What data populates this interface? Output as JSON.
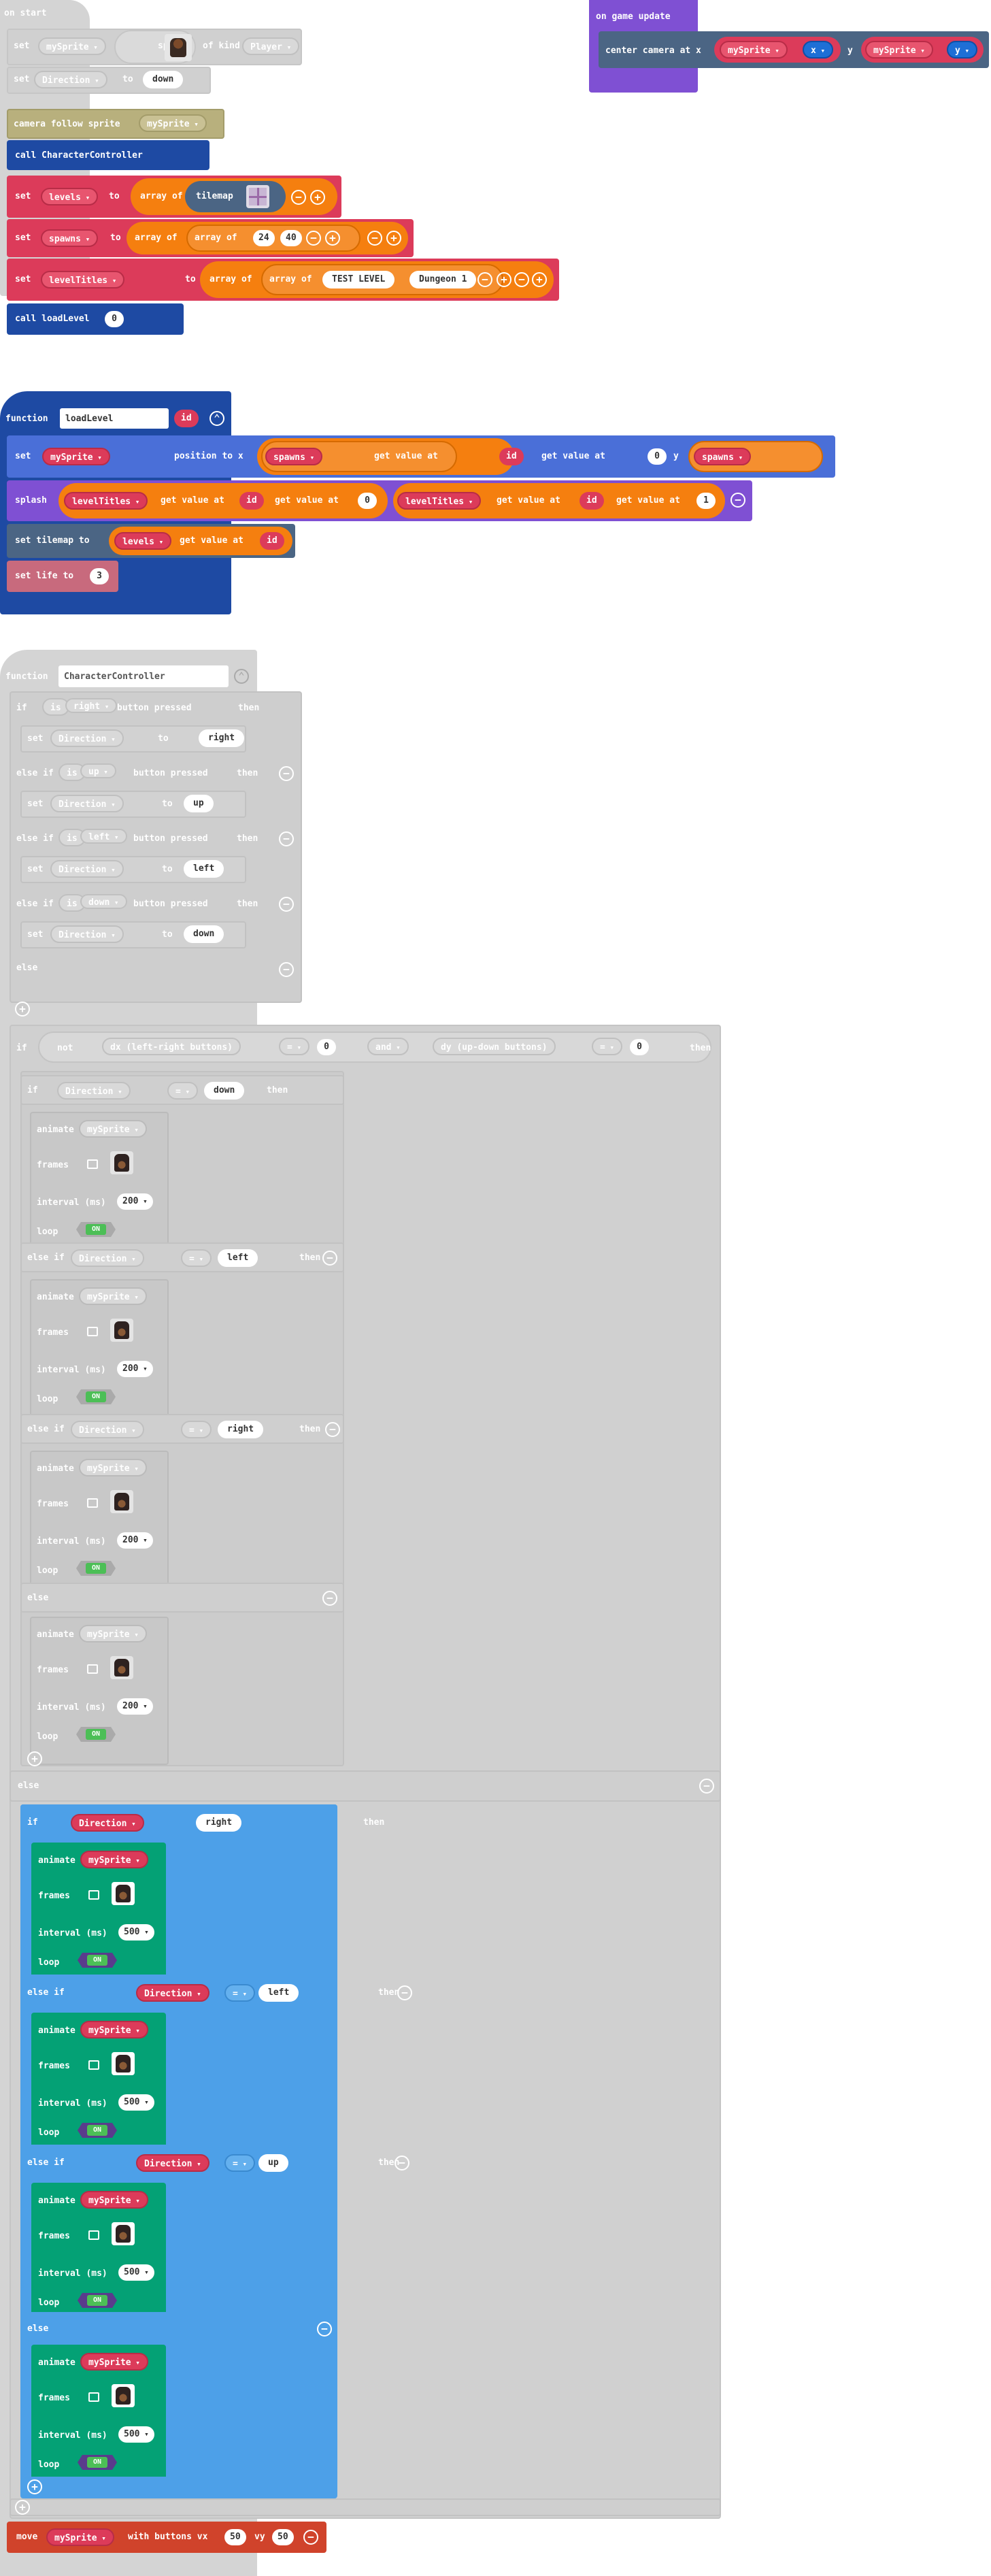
{
  "on_start": {
    "hat": "on start",
    "set1": {
      "set": "set",
      "var": "mySprite",
      "to": "to",
      "sprite": "sprite",
      "of_kind": "of kind",
      "kind": "Player"
    },
    "set2": {
      "set": "set",
      "var": "Direction",
      "to": "to",
      "value": "down"
    },
    "camera": {
      "label": "camera follow sprite",
      "var": "mySprite"
    },
    "call": "call CharacterController",
    "set_levels": {
      "set": "set",
      "var": "levels",
      "to": "to",
      "array_of": "array of",
      "tilemap": "tilemap"
    },
    "set_spawns": {
      "set": "set",
      "var": "spawns",
      "to": "to",
      "array_of": "array of",
      "v1": "24",
      "v2": "40"
    },
    "set_titles": {
      "set": "set",
      "var": "levelTitles",
      "to": "to",
      "array_of": "array of",
      "v1": "TEST LEVEL",
      "v2": "Dungeon 1"
    },
    "call_load": {
      "label": "call loadLevel",
      "arg": "0"
    }
  },
  "on_update": {
    "hat": "on game update",
    "center": "center camera at x",
    "var": "mySprite",
    "x": "x",
    "y_label": "y",
    "y": "y"
  },
  "load_level": {
    "function": "function",
    "name": "loadLevel",
    "param": "id",
    "set": "set",
    "sprite": "mySprite",
    "position": "position to x",
    "spawns": "spawns",
    "get_value_at": "get value at",
    "zero": "0",
    "one": "1",
    "y": "y",
    "splash": "splash",
    "level_titles": "levelTitles",
    "set_tilemap": "set tilemap to",
    "levels": "levels",
    "set_life": "set life to",
    "life": "3"
  },
  "controller": {
    "function": "function",
    "name": "CharacterController",
    "if": "if",
    "else_if": "else if",
    "else": "else",
    "then": "then",
    "is": "is",
    "button_pressed": "button pressed",
    "set": "set",
    "direction": "Direction",
    "to": "to",
    "buttons": [
      "right",
      "up",
      "left",
      "down"
    ],
    "values": [
      "right",
      "up",
      "left",
      "down"
    ],
    "not": "not",
    "dx": "dx (left-right buttons)",
    "dy": "dy (up-down buttons)",
    "eq": "=",
    "and": "and",
    "zero": "0",
    "animate": "animate",
    "sprite": "mySprite",
    "frames": "frames",
    "interval": "interval (ms)",
    "loop": "loop",
    "on": "ON",
    "idle_interval": "200",
    "walk_interval": "500",
    "idle_dirs": [
      "down",
      "left",
      "right"
    ],
    "walk_dirs": [
      "right",
      "left",
      "up"
    ],
    "move": "move",
    "with_buttons": "with buttons vx",
    "vy": "vy",
    "speed": "50"
  },
  "colors": {
    "disabled": "#cccccc",
    "variables": "#dc3b5a",
    "arrays": "#f57f0f",
    "functions": "#1e4aa3",
    "logic": "#4da0e8",
    "animation": "#04a175",
    "scene": "#4b6584",
    "game": "#7f50d3",
    "controller": "#d0432b",
    "info": "#c86a7d"
  }
}
